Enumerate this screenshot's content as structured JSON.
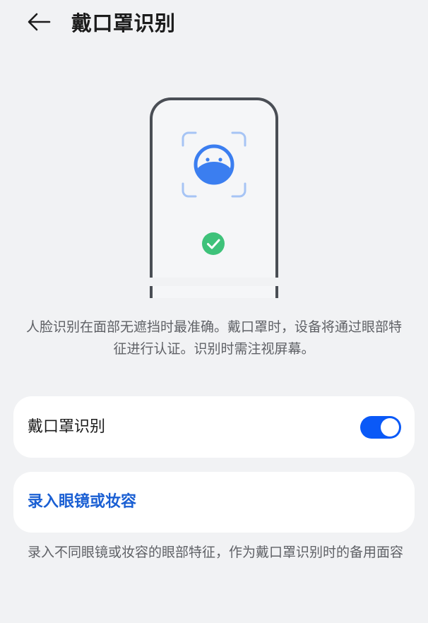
{
  "header": {
    "title": "戴口罩识别",
    "back_icon": "arrow-left-icon"
  },
  "illustration": {
    "icons": [
      "phone-outline",
      "masked-face-scan-icon",
      "check-circle-icon"
    ],
    "colors": {
      "face": "#3b7ef0",
      "scan_frame": "#a6c4f5",
      "check": "#3ec27a",
      "phone_frame": "#4a4e55"
    }
  },
  "description": "人脸识别在面部无遮挡时最准确。戴口罩时，设备将通过眼部特征进行认证。识别时需注视屏幕。",
  "mask_toggle": {
    "label": "戴口罩识别",
    "enabled": true,
    "accent": "#0a59f7"
  },
  "enroll": {
    "label": "录入眼镜或妆容",
    "color": "#1a5fd3"
  },
  "footnote": "录入不同眼镜或妆容的眼部特征，作为戴口罩识别时的备用面容"
}
